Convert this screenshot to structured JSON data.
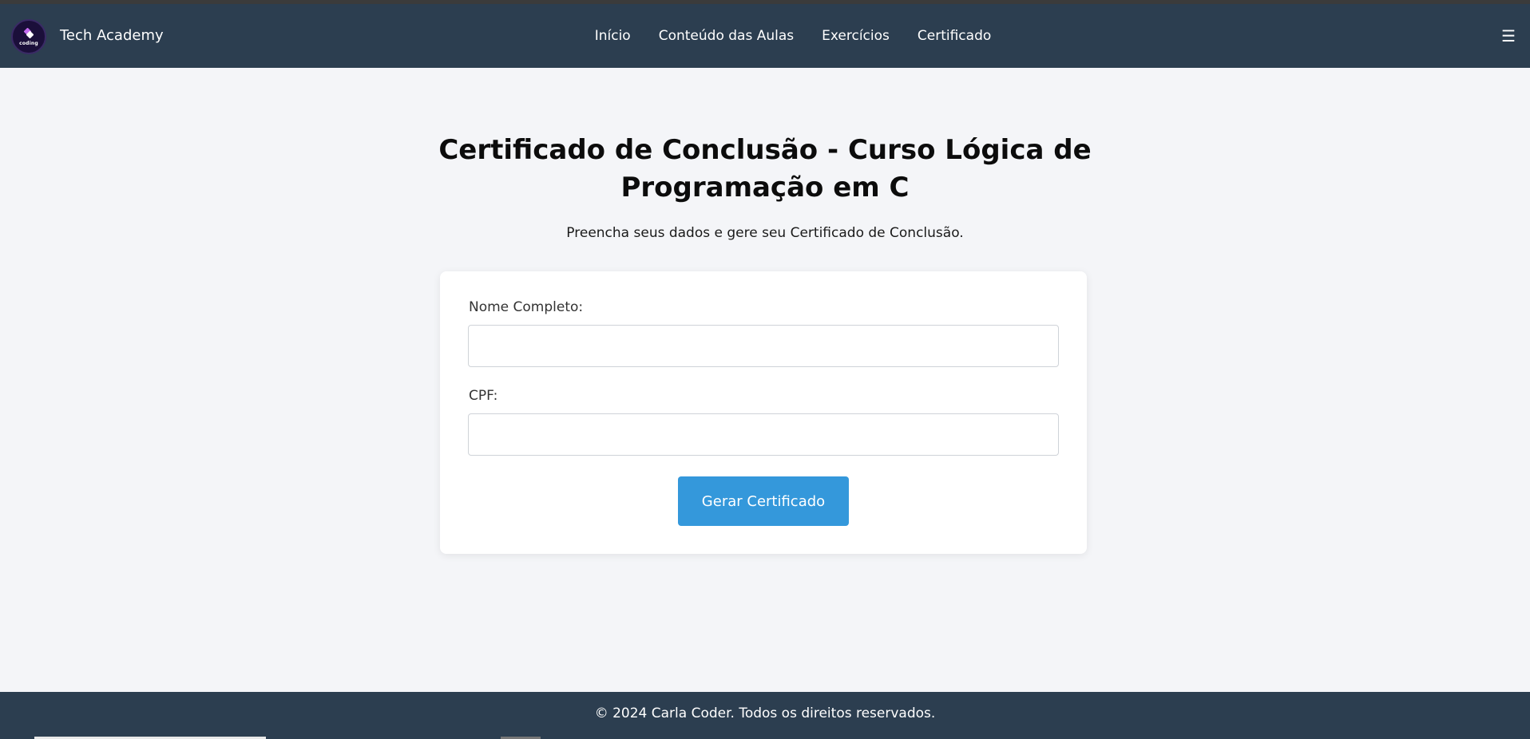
{
  "header": {
    "logo_text": "coding",
    "brand": "Tech Academy",
    "nav": [
      {
        "label": "Início"
      },
      {
        "label": "Conteúdo das Aulas"
      },
      {
        "label": "Exercícios"
      },
      {
        "label": "Certificado"
      }
    ],
    "menu_icon": "☰"
  },
  "main": {
    "title_line1": "Certificado de Conclusão - Curso Lógica de",
    "title_line2": "Programação em C",
    "subtitle": "Preencha seus dados e gere seu Certificado de Conclusão.",
    "form": {
      "name_label": "Nome Completo:",
      "name_value": "",
      "cpf_label": "CPF:",
      "cpf_value": "",
      "submit_label": "Gerar Certificado"
    }
  },
  "footer": {
    "text": "© 2024 Carla Coder. Todos os direitos reservados."
  },
  "colors": {
    "header_bg": "#2c3e50",
    "page_bg": "#f4f5f8",
    "button_bg": "#3498db",
    "card_bg": "#ffffff"
  },
  "icons": {
    "logo": "coding-logo-icon",
    "menu": "hamburger-menu-icon"
  }
}
